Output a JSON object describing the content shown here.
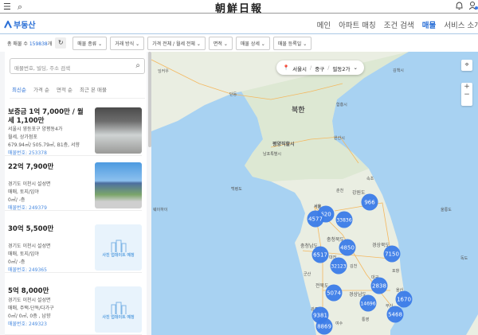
{
  "header": {
    "logo": "朝鮮日報",
    "menu_icon": "☰",
    "search_icon": "⌕",
    "bell_icon": "🔔",
    "user_icon": "person"
  },
  "nav": {
    "brand": "부동산",
    "items": [
      {
        "label": "메인"
      },
      {
        "label": "아파트 매칭"
      },
      {
        "label": "조건 검색"
      },
      {
        "label": "매물",
        "active": true
      },
      {
        "label": "서비스 소개"
      }
    ]
  },
  "filters": {
    "count_label": "총 매물 수",
    "count": "159838",
    "count_suffix": "개",
    "refresh": "↻",
    "buttons": [
      "매물 종류 ⌄",
      "거래 방식 ⌄",
      "가격 전체 / 월세 전체 ⌄",
      "면적 ⌄",
      "매물 상세 ⌄",
      "매물 등록일 ⌄"
    ]
  },
  "search": {
    "placeholder": "매물번호, 빌딩, 주소 검색"
  },
  "sorts": [
    "최신순",
    "가격 순",
    "면적 순",
    "최근 본 매물"
  ],
  "listings": [
    {
      "price": "보증금 1억 7,000만 / 월세 1,100만",
      "address": "서울시 영등포구 양평동4가",
      "type": "월세, 상가점포",
      "area": "679.94㎡/ 505.79㎡, B1층, 서향",
      "number": "매물번호: 253378",
      "image": "photo-interior"
    },
    {
      "price": "22억 7,900만",
      "address": "경기도 이천시 설성면",
      "type": "매매, 토지/임야",
      "area": "0㎡/ -층",
      "number": "매물번호: 249379",
      "image": "photo-building"
    },
    {
      "price": "30억 5,500만",
      "address": "경기도 이천시 설성면",
      "type": "매매, 토지/임야",
      "area": "0㎡/ -층",
      "number": "매물번호: 249365",
      "image": "placeholder"
    },
    {
      "price": "5억 8,000만",
      "address": "경기도 이천시 설성면",
      "type": "매매, 주택-단독/다가구",
      "area": "0㎡/ 0㎡, 0층 , 남향",
      "number": "매물번호: 249323",
      "image": "placeholder"
    }
  ],
  "placeholder_text": "사진 업데이트 예정",
  "map": {
    "breadcrumb": [
      "서울시",
      "중구",
      "필동2가"
    ],
    "zoom_in": "+",
    "zoom_out": "−",
    "labels": [
      "북한",
      "평양직할시",
      "남포특별시",
      "원산시",
      "함흥시",
      "김책시",
      "단둥",
      "잉커우",
      "웨이하이",
      "백령도",
      "춘천",
      "속초",
      "강원도",
      "서울",
      "충청북도",
      "충청남도",
      "경상북도",
      "대전",
      "김천",
      "군산",
      "전북도",
      "경상남도",
      "대구",
      "포항",
      "울산",
      "부산",
      "통영",
      "여수",
      "광주",
      "울릉도",
      "독도"
    ],
    "clusters": [
      "966",
      "620",
      "4577",
      "33836",
      "4850",
      "6517",
      "7150",
      "32123",
      "2838",
      "5074",
      "14696",
      "1670",
      "5468",
      "9381",
      "8869"
    ]
  },
  "colors": {
    "accent": "#2a6fd6",
    "cluster": "#3b7be8",
    "sea": "#a8d2f2",
    "land": "#eaeee2"
  }
}
